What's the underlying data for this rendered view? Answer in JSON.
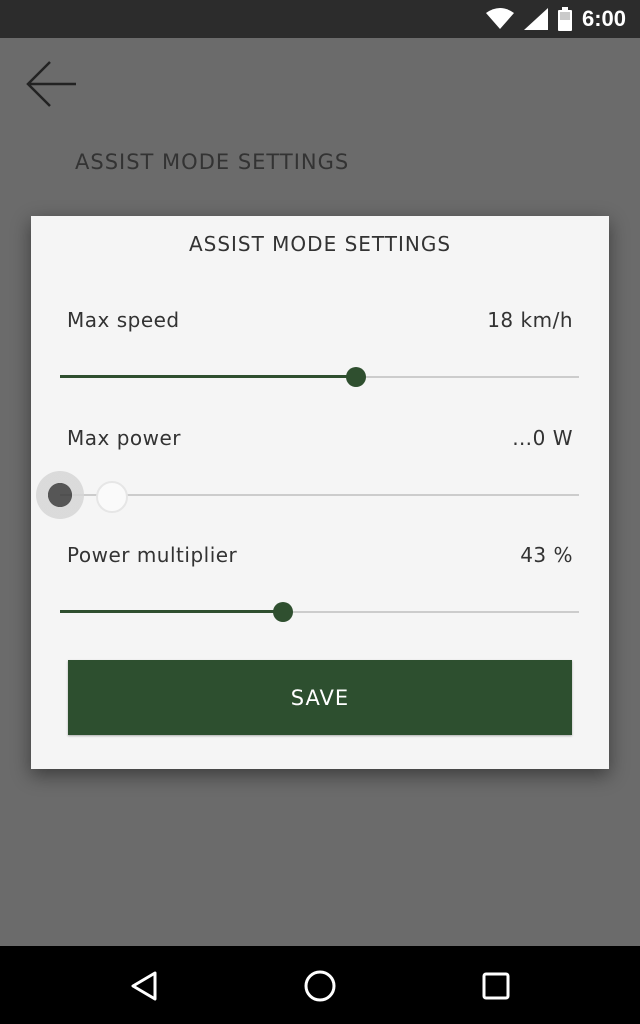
{
  "status_bar": {
    "time": "6:00",
    "icons": [
      "wifi-icon",
      "signal-icon",
      "battery-icon"
    ]
  },
  "background": {
    "title": "ASSIST MODE SETTINGS",
    "subtitle": "__"
  },
  "dialog": {
    "title": "ASSIST MODE SETTINGS",
    "settings": [
      {
        "label": "Max speed",
        "value": "18 km/h",
        "level": 0.57
      },
      {
        "label": "Max power",
        "value": "…0 W",
        "level": 0.0
      },
      {
        "label": "Power multiplier",
        "value": "43 %",
        "level": 0.43
      }
    ],
    "save_label": "SAVE"
  },
  "colors": {
    "accent": "#2d4f2f",
    "scrim": "#6b6b6b",
    "dialog_bg": "#f5f5f5",
    "status_bar": "#2c2c2c",
    "nav_bar": "#000000"
  },
  "nav": {
    "icons": [
      "back-triangle-icon",
      "home-circle-icon",
      "recents-square-icon"
    ]
  }
}
